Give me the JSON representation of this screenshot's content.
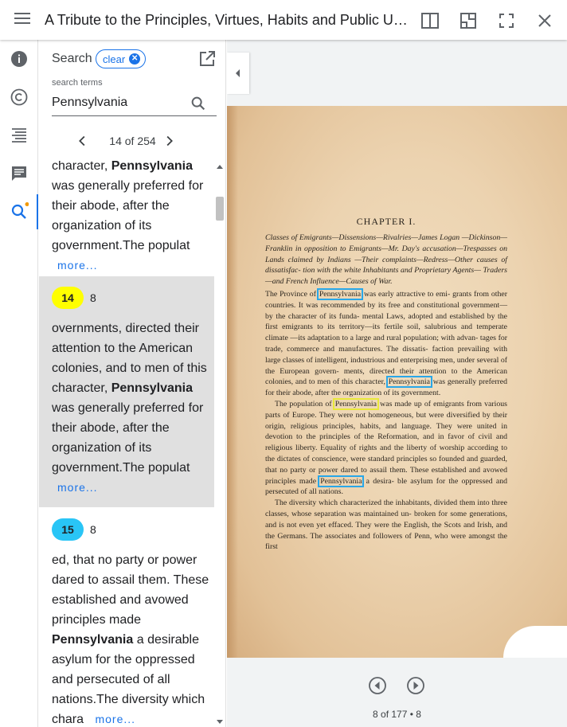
{
  "header": {
    "title": "A Tribute to the Principles, Virtues, Habits and Public Usefulness of the Irish and Scotch Early Settlers of Pennsylvania"
  },
  "sidebar": {
    "items": [
      {
        "name": "info",
        "icon": "info-icon"
      },
      {
        "name": "copyright",
        "icon": "copyright-icon"
      },
      {
        "name": "contents",
        "icon": "toc-icon"
      },
      {
        "name": "comments",
        "icon": "comment-icon"
      },
      {
        "name": "search",
        "icon": "search-icon",
        "active": true
      }
    ]
  },
  "search": {
    "label": "Search",
    "clear_label": "clear",
    "terms_label": "search terms",
    "value": "Pennsylvania",
    "pager": "14 of 254"
  },
  "results": [
    {
      "partial": true,
      "before": "",
      "term": "",
      "lines": "was generally preferred for their abode, after the organization of its government.The populat",
      "more": "more..."
    },
    {
      "number": "14",
      "page": "8",
      "badge_color": "#ffff00",
      "before": "overnments, directed their attention to the American colonies, and to men of this character, ",
      "term": "Pennsylvania",
      "after": " was generally preferred for their abode, after the organization of its government.The populat",
      "more": "more..."
    },
    {
      "number": "15",
      "page": "8",
      "badge_color": "#29c5f6",
      "before": "ed, that no party or power dared to assail them. These established and avowed principles made ",
      "term": "Pennsylvania",
      "after": " a desirable asylum for the oppressed and persecuted of all nations.The diversity which chara",
      "more": "more..."
    }
  ],
  "viewer": {
    "status": "8 of 177 • 8",
    "highlight_color": "#29a7e8",
    "current_highlight_color": "#e8e83a",
    "page": {
      "chapter": "CHAPTER I.",
      "summary": "Classes of Emigrants—Dissensions—Rivalries—James Logan —Dickinson—Franklin in opposition to Emigrants—Mr. Day's accusation—Trespasses on Lands claimed by Indians —Their complaints—Redress—Other causes of dissatisfac- tion with the white Inhabitants and Proprietary Agents— Traders—and French Influence—Causes of War.",
      "p1_a": "The Province of ",
      "term": "Pennsylvania",
      "p1_b": " was early attractive to emi- grants from other countries. It was recommended by its free and constitutional government—by the character of its funda- mental Laws, adopted and established by the first emigrants to its territory—its fertile soil, salubrious and temperate climate —its adaptation to a large and rural population; with advan- tages for trade, commerce and manufactures. The dissatis- faction prevailing with large classes of intelligent, industrious and enterprising men, under several of the European govern- ments, directed their attention to the American colonies, and to men of this character, ",
      "p1_c": " was generally preferred for their abode, after the organization of its government.",
      "p2_a": "The population of ",
      "p2_b": " was made up of emigrants from various parts of Europe. They were not homogeneous, but were diversified by their origin, religious principles, habits, and language. They were united in devotion to the principles of the Reformation, and in favor of civil and religious liberty. Equality of rights and the liberty of worship according to the dictates of conscience, were standard principles so founded and guarded, that no party or power dared to assail them. These established and avowed principles made ",
      "p2_c": " a desira- ble asylum for the oppressed and persecuted of all nations.",
      "p3": "The diversity which characterized the inhabitants, divided them into three classes, whose separation was maintained un- broken for some generations, and is not even yet effaced. They were the English, the Scots and Irish, and the Germans. The associates and followers of Penn, who were amongst the first"
    }
  }
}
